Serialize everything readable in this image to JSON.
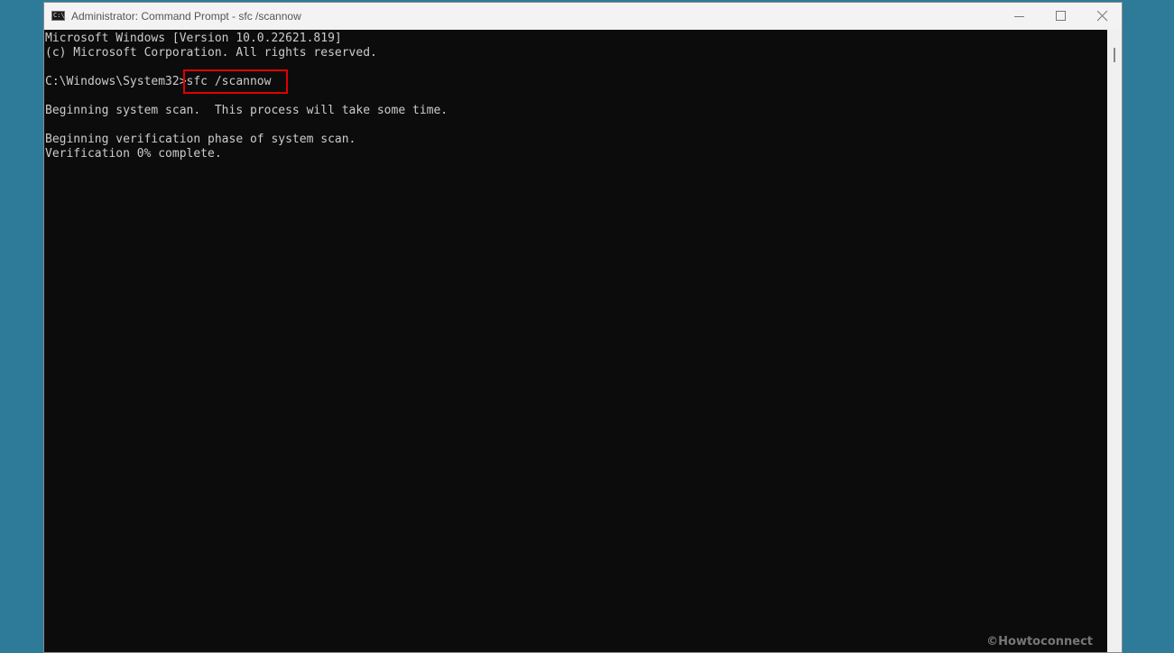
{
  "window": {
    "title": "Administrator: Command Prompt - sfc  /scannow",
    "icon": "cmd-icon",
    "icon_text": "C:\\_",
    "controls": [
      "minimize",
      "maximize",
      "close"
    ]
  },
  "console": {
    "lines": [
      "Microsoft Windows [Version 10.0.22621.819]",
      "(c) Microsoft Corporation. All rights reserved.",
      "",
      "C:\\Windows\\System32>sfc /scannow",
      "",
      "Beginning system scan.  This process will take some time.",
      "",
      "Beginning verification phase of system scan.",
      "Verification 0% complete."
    ],
    "highlighted_command": "sfc /scannow",
    "highlight_color": "#e00000",
    "background": "#0c0c0c",
    "text_color": "#cccccc"
  },
  "watermark": "©Howtoconnect"
}
